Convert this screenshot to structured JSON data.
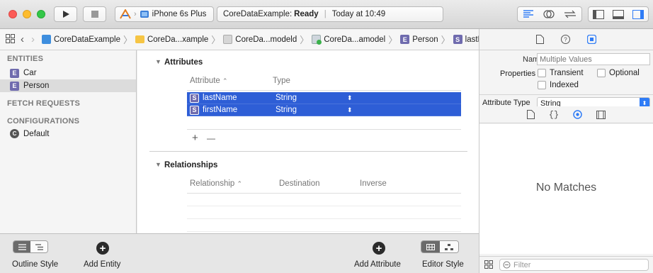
{
  "toolbar": {
    "scheme_device": "iPhone 6s Plus",
    "status_project": "CoreDataExample:",
    "status_state": "Ready",
    "status_time": "Today at 10:49"
  },
  "pathbar": {
    "crumbs": [
      "CoreDataExample",
      "CoreDa...xample",
      "CoreDa...modeld",
      "CoreDa...amodel",
      "Person",
      "lastName"
    ]
  },
  "sidebar": {
    "entities_header": "ENTITIES",
    "entities": [
      {
        "badge": "E",
        "label": "Car"
      },
      {
        "badge": "E",
        "label": "Person"
      }
    ],
    "fetch_header": "FETCH REQUESTS",
    "config_header": "CONFIGURATIONS",
    "configs": [
      {
        "badge": "C",
        "label": "Default"
      }
    ]
  },
  "attributes": {
    "title": "Attributes",
    "col_attribute": "Attribute",
    "col_type": "Type",
    "rows": [
      {
        "badge": "S",
        "name": "lastName",
        "type": "String"
      },
      {
        "badge": "S",
        "name": "firstName",
        "type": "String"
      }
    ],
    "add_symbol": "+",
    "remove_symbol": "—"
  },
  "relationships": {
    "title": "Relationships",
    "col_relationship": "Relationship",
    "col_destination": "Destination",
    "col_inverse": "Inverse"
  },
  "bottom": {
    "outline_style": "Outline Style",
    "add_entity": "Add Entity",
    "add_attribute": "Add Attribute",
    "editor_style": "Editor Style"
  },
  "inspector": {
    "name_label": "Name",
    "name_placeholder": "Multiple Values",
    "properties_label": "Properties",
    "transient": "Transient",
    "optional": "Optional",
    "indexed": "Indexed",
    "attribute_type_label": "Attribute Type",
    "attribute_type_value": "String",
    "no_matches": "No Matches",
    "filter_placeholder": "Filter"
  },
  "colors": {
    "selection": "#2e5ed6",
    "entity_badge": "#6f6bae",
    "accent": "#2f7cf6"
  }
}
